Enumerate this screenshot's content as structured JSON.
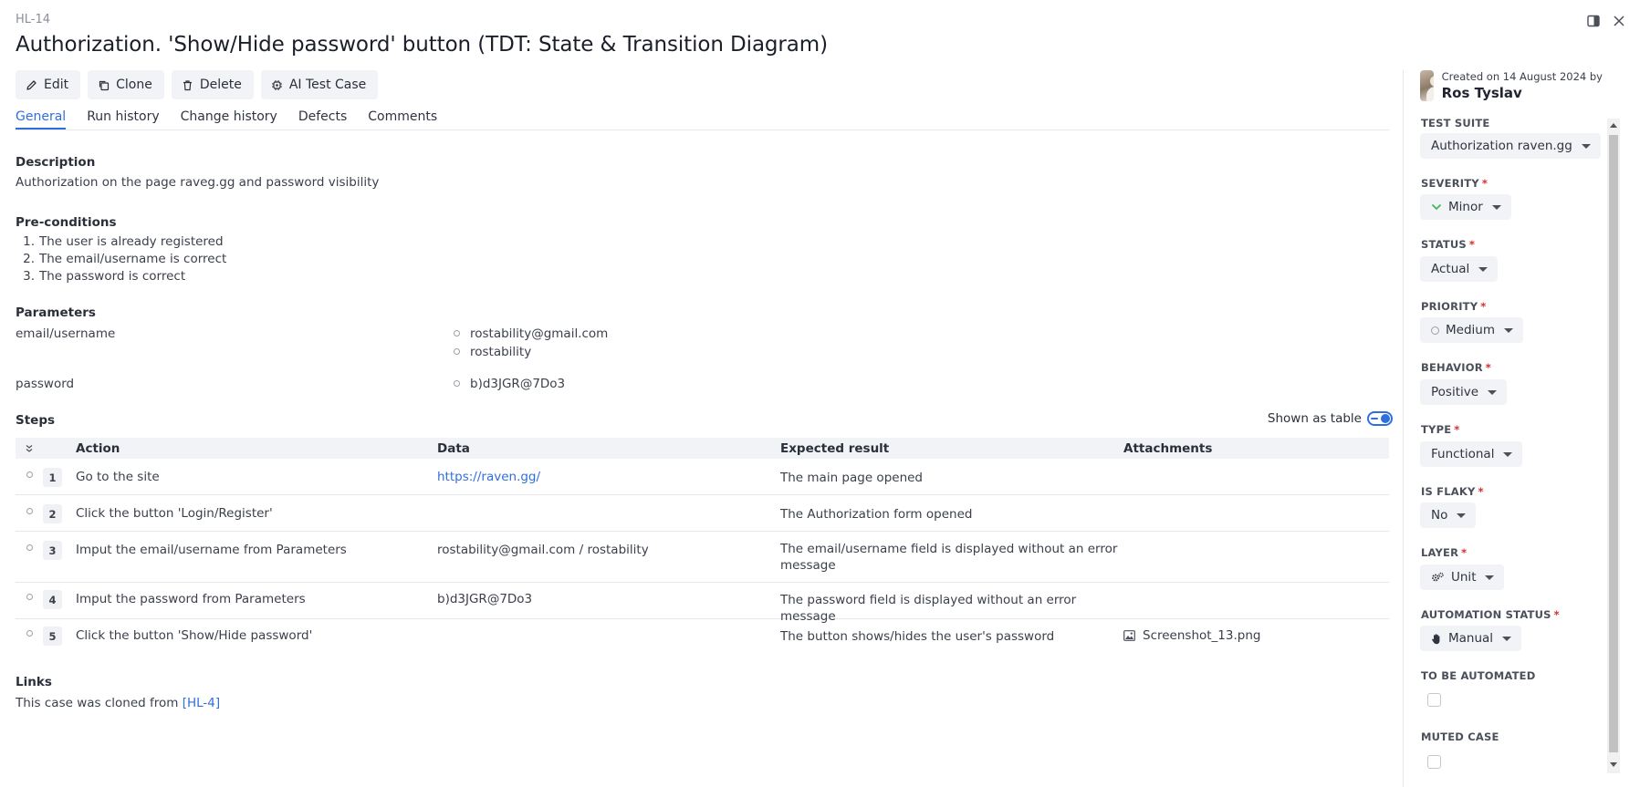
{
  "case": {
    "id": "HL-14",
    "title": "Authorization. 'Show/Hide password' button (TDT: State & Transition Diagram)"
  },
  "toolbar": {
    "edit": "Edit",
    "clone": "Clone",
    "delete": "Delete",
    "ai": "AI Test Case"
  },
  "tabs": [
    "General",
    "Run history",
    "Change history",
    "Defects",
    "Comments"
  ],
  "description": {
    "heading": "Description",
    "text": "Authorization on the page raveg.gg and password visibility"
  },
  "preconditions": {
    "heading": "Pre-conditions",
    "items": [
      "The user is already registered",
      "The email/username is correct",
      "The password is correct"
    ]
  },
  "parameters": {
    "heading": "Parameters",
    "rows": [
      {
        "name": "email/username",
        "values": [
          "rostability@gmail.com",
          "rostability"
        ]
      },
      {
        "name": "password",
        "values": [
          "b)d3JGR@7Do3"
        ]
      }
    ]
  },
  "steps": {
    "heading": "Steps",
    "shown_as_table": "Shown as table",
    "columns": [
      "Action",
      "Data",
      "Expected result",
      "Attachments"
    ],
    "rows": [
      {
        "num": "1",
        "action": "Go to the site",
        "data": "https://raven.gg/",
        "expected": "The main page opened",
        "attachment": ""
      },
      {
        "num": "2",
        "action": "Click the button 'Login/Register'",
        "data": "",
        "expected": "The Authorization form opened",
        "attachment": ""
      },
      {
        "num": "3",
        "action": "Imput the email/username from Parameters",
        "data": "rostability@gmail.com / rostability",
        "expected": "The email/username field is displayed without an error message",
        "attachment": ""
      },
      {
        "num": "4",
        "action": "Imput the password from Parameters",
        "data": "b)d3JGR@7Do3",
        "expected": "The password field is displayed without an error message",
        "attachment": ""
      },
      {
        "num": "5",
        "action": "Click the button 'Show/Hide password'",
        "data": "",
        "expected": "The button shows/hides the user's password",
        "attachment": "Screenshot_13.png"
      }
    ]
  },
  "links": {
    "heading": "Links",
    "prefix": "This case was cloned from ",
    "link_text": "[HL-4]"
  },
  "sidebar": {
    "created": "Created on 14 August 2024 by",
    "author": "Ros Tyslav",
    "fields": {
      "test_suite": {
        "label": "TEST SUITE",
        "value": "Authorization raven.gg"
      },
      "severity": {
        "label": "SEVERITY",
        "value": "Minor"
      },
      "status": {
        "label": "STATUS",
        "value": "Actual"
      },
      "priority": {
        "label": "PRIORITY",
        "value": "Medium"
      },
      "behavior": {
        "label": "BEHAVIOR",
        "value": "Positive"
      },
      "type": {
        "label": "TYPE",
        "value": "Functional"
      },
      "is_flaky": {
        "label": "IS FLAKY",
        "value": "No"
      },
      "layer": {
        "label": "LAYER",
        "value": "Unit"
      },
      "automation_status": {
        "label": "AUTOMATION STATUS",
        "value": "Manual"
      },
      "to_be_automated": {
        "label": "TO BE AUTOMATED"
      },
      "muted_case": {
        "label": "MUTED CASE"
      }
    },
    "required_mark": "*"
  },
  "colors": {
    "accent": "#2f6fdb",
    "required": "#d92d2d",
    "severity_minor": "#3fb950"
  },
  "icons": {
    "edit": "pencil-icon",
    "clone": "clone-icon",
    "delete": "trash-icon",
    "ai": "cpu-icon",
    "panel": "panel-toggle-icon",
    "close": "close-icon",
    "attachment": "image-icon",
    "layer": "gears-icon",
    "automation": "hand-icon"
  }
}
